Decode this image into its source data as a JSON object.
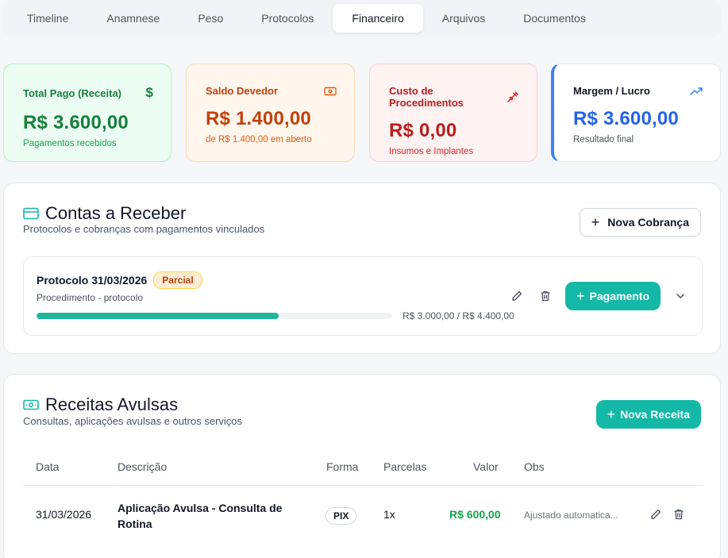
{
  "tabs": [
    {
      "label": "Timeline",
      "active": false
    },
    {
      "label": "Anamnese",
      "active": false
    },
    {
      "label": "Peso",
      "active": false
    },
    {
      "label": "Protocolos",
      "active": false
    },
    {
      "label": "Financeiro",
      "active": true
    },
    {
      "label": "Arquivos",
      "active": false
    },
    {
      "label": "Documentos",
      "active": false
    }
  ],
  "stats": {
    "paid": {
      "title": "Total Pago (Receita)",
      "value": "R$ 3.600,00",
      "sub": "Pagamentos recebidos",
      "icon": "dollar-icon",
      "color": "#15803d"
    },
    "due": {
      "title": "Saldo Devedor",
      "value": "R$ 1.400,00",
      "sub": "de R$ 1.400,00 em aberto",
      "icon": "banknote-icon",
      "color": "#c2410c"
    },
    "cost": {
      "title": "Custo de Procedimentos",
      "value": "R$ 0,00",
      "sub": "Insumos e Implantes",
      "icon": "syringe-icon",
      "color": "#b91c1c"
    },
    "margin": {
      "title": "Margem / Lucro",
      "value": "R$ 3.600,00",
      "sub": "Resultado final",
      "icon": "trending-up-icon",
      "color": "#2563eb"
    }
  },
  "receivables": {
    "title": "Contas a Receber",
    "subtitle": "Protocolos e cobranças com pagamentos vinculados",
    "new_button": "Nova Cobrança",
    "item": {
      "title": "Protocolo 31/03/2026",
      "badge": "Parcial",
      "subtitle": "Procedimento - protocolo",
      "progress": 0.6818,
      "progress_label": "R$ 3.000,00 / R$ 4.400,00",
      "pay_button": "Pagamento"
    }
  },
  "revenues": {
    "title": "Receitas Avulsas",
    "subtitle": "Consultas, aplicações avulsas e outros serviços",
    "new_button": "Nova Receita",
    "columns": {
      "date": "Data",
      "desc": "Descrição",
      "method": "Forma",
      "installments": "Parcelas",
      "value": "Valor",
      "notes": "Obs"
    },
    "rows": [
      {
        "date": "31/03/2026",
        "desc": "Aplicação Avulsa - Consulta de Rotina",
        "method": "PIX",
        "installments": "1x",
        "value": "R$ 600,00",
        "notes": "Ajustado automatica..."
      }
    ]
  },
  "colors": {
    "accent": "#14b8a6",
    "success": "#16a34a"
  }
}
